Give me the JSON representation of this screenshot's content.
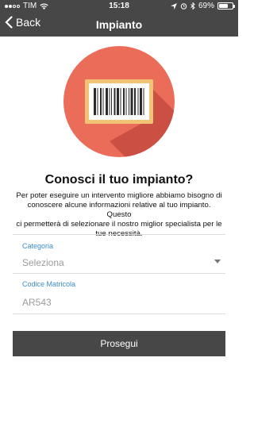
{
  "status_bar": {
    "carrier": "TIM",
    "time": "15:18",
    "battery_text": "69%",
    "battery_level": 0.69
  },
  "nav": {
    "back_label": "Back",
    "title": "Impianto"
  },
  "hero": {
    "icon": "barcode-icon",
    "colors": {
      "circle": "#ec6c5a",
      "shadow": "#cc4f44",
      "card_border": "#f2c374",
      "card_fill": "#ffffff",
      "bars": "#2b2b2b"
    }
  },
  "intro": {
    "heading": "Conosci il tuo impianto?",
    "lines": [
      "Per poter eseguire un intervento migliore abbiamo bisogno di",
      "conoscere alcune informazioni relative al tuo impianto. Questo",
      "ci permetterà di selezionare il nostro miglior specialista per le",
      "tue necessità."
    ]
  },
  "form": {
    "category_label": "Categoria",
    "category_value": "Seleziona",
    "serial_label": "Codice Matricola",
    "serial_placeholder": "AR543"
  },
  "submit_label": "Prosegui",
  "colors": {
    "header": "#474747",
    "accent": "#3a8fc8",
    "button": "#474747"
  }
}
